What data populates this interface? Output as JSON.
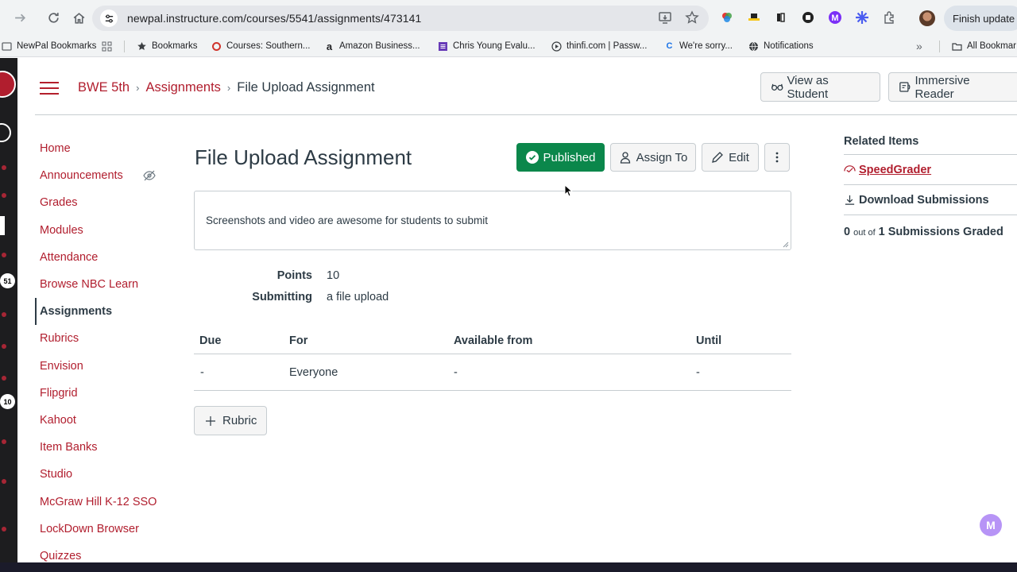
{
  "browser": {
    "url": "newpal.instructure.com/courses/5541/assignments/473141",
    "finish_update": "Finish update",
    "bookmarks": [
      {
        "label": "NewPal Bookmarks",
        "icon": "tab-group-icon"
      },
      {
        "label": "",
        "icon": "apps-grid-icon"
      },
      {
        "label": "Bookmarks",
        "icon": "star-icon"
      },
      {
        "label": "Courses: Southern...",
        "icon": "red-favicon"
      },
      {
        "label": "Amazon Business...",
        "icon": "amazon-icon"
      },
      {
        "label": "Chris Young Evalu...",
        "icon": "form-icon"
      },
      {
        "label": "thinfi.com | Passw...",
        "icon": "play-circle-icon"
      },
      {
        "label": "We're sorry...",
        "icon": "cq-icon"
      },
      {
        "label": "Notifications",
        "icon": "globe-icon"
      }
    ],
    "all_bookmarks": "All Bookmar"
  },
  "header": {
    "crumbs": [
      "BWE 5th",
      "Assignments",
      "File Upload Assignment"
    ],
    "view_as_student": "View as Student",
    "immersive_reader": "Immersive Reader"
  },
  "nav": [
    {
      "label": "Home"
    },
    {
      "label": "Announcements",
      "hidden": true
    },
    {
      "label": "Grades"
    },
    {
      "label": "Modules"
    },
    {
      "label": "Attendance"
    },
    {
      "label": "Browse NBC Learn"
    },
    {
      "label": "Assignments",
      "active": true
    },
    {
      "label": "Rubrics"
    },
    {
      "label": "Envision"
    },
    {
      "label": "Flipgrid"
    },
    {
      "label": "Kahoot"
    },
    {
      "label": "Item Banks"
    },
    {
      "label": "Studio"
    },
    {
      "label": "McGraw Hill K-12 SSO"
    },
    {
      "label": "LockDown Browser"
    },
    {
      "label": "Quizzes"
    }
  ],
  "assignment": {
    "title": "File Upload Assignment",
    "published": "Published",
    "assign_to": "Assign To",
    "edit": "Edit",
    "description": "Screenshots and video are awesome for students to submit",
    "points_label": "Points",
    "points": "10",
    "submitting_label": "Submitting",
    "submitting": "a file upload",
    "table": {
      "headers": [
        "Due",
        "For",
        "Available from",
        "Until"
      ],
      "row": [
        "-",
        "Everyone",
        "-",
        "-"
      ]
    },
    "rubric": "Rubric"
  },
  "related": {
    "title": "Related Items",
    "speedgrader": "SpeedGrader",
    "download": "Download Submissions",
    "graded_count": "0",
    "graded_mid": "out of",
    "graded_total": "1 Submissions Graded"
  },
  "strip": {
    "badge1": "51",
    "badge2": "10"
  },
  "colors": {
    "brand": "#b11e2e",
    "published": "#0b874b",
    "text": "#2d3b45"
  }
}
